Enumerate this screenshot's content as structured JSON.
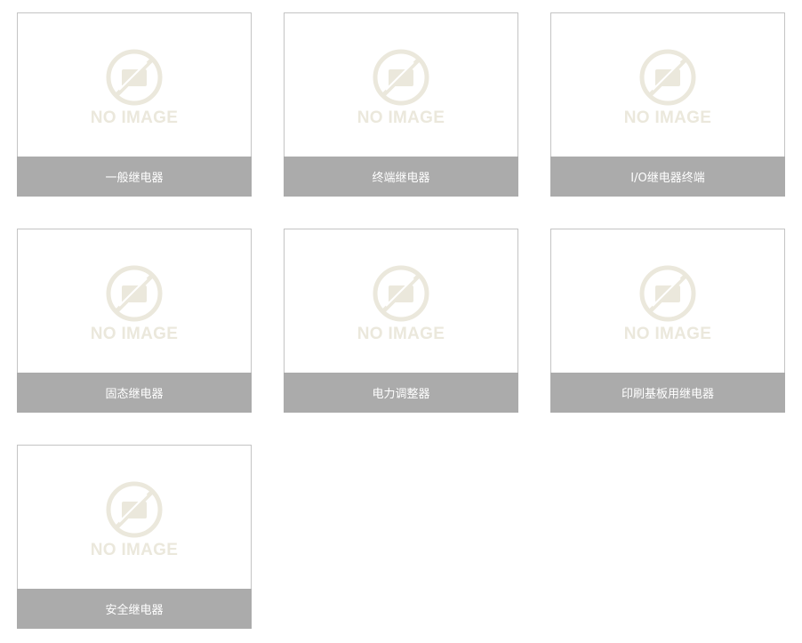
{
  "colors": {
    "placeholder": "#ebe8dc",
    "label_bg": "#ababab",
    "label_text": "#ffffff",
    "card_border": "#c4c4c4"
  },
  "products": [
    {
      "label": "一般继电器",
      "placeholder_text": "NO IMAGE",
      "icon": "no-image-icon"
    },
    {
      "label": "终端继电器",
      "placeholder_text": "NO IMAGE",
      "icon": "no-image-icon"
    },
    {
      "label": "I/O继电器终端",
      "placeholder_text": "NO IMAGE",
      "icon": "no-image-icon"
    },
    {
      "label": "固态继电器",
      "placeholder_text": "NO IMAGE",
      "icon": "no-image-icon"
    },
    {
      "label": "电力调整器",
      "placeholder_text": "NO IMAGE",
      "icon": "no-image-icon"
    },
    {
      "label": "印刷基板用继电器",
      "placeholder_text": "NO IMAGE",
      "icon": "no-image-icon"
    },
    {
      "label": "安全继电器",
      "placeholder_text": "NO IMAGE",
      "icon": "no-image-icon"
    }
  ]
}
